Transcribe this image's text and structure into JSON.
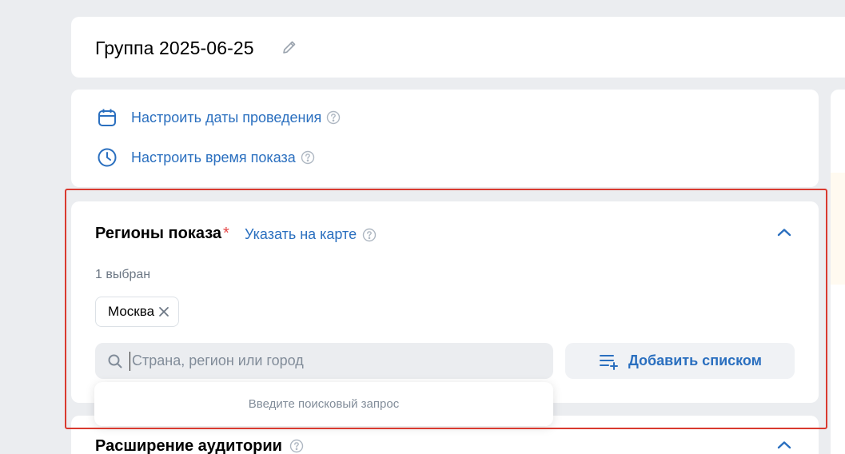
{
  "group": {
    "title": "Группа 2025-06-25"
  },
  "schedule": {
    "dates_link": "Настроить даты проведения",
    "time_link": "Настроить время показа"
  },
  "regions": {
    "title": "Регионы показа",
    "required_mark": "*",
    "map_link": "Указать на карте",
    "selected_count": "1 выбран",
    "chips": [
      {
        "label": "Москва"
      }
    ],
    "search": {
      "value": "",
      "placeholder": "Страна, регион или город"
    },
    "add_list_label": "Добавить списком",
    "dropdown_hint": "Введите поисковый запрос"
  },
  "audience": {
    "title": "Расширение аудитории"
  },
  "colors": {
    "accent": "#2a6fbf",
    "background": "#ebedf0",
    "required": "#e64646",
    "highlight": "#d93a2f"
  },
  "icons": {
    "edit": "pencil-icon",
    "dates": "calendar-icon",
    "time": "clock-icon",
    "help": "question-circle-icon",
    "collapse": "chevron-up-icon",
    "remove_chip": "close-icon",
    "search": "search-icon",
    "add_list": "list-add-icon"
  }
}
